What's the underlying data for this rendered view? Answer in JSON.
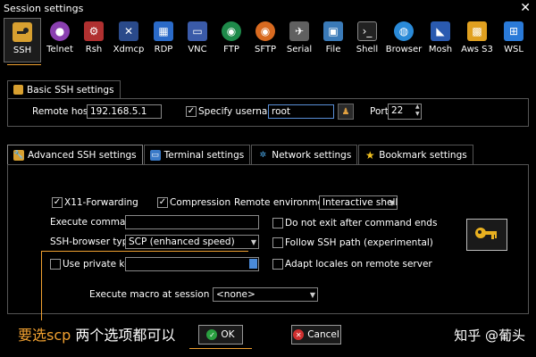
{
  "window": {
    "title": "Session settings",
    "close_glyph": "✕"
  },
  "protocols": [
    {
      "label": "SSH",
      "icon": "ssh-icon",
      "selected": true
    },
    {
      "label": "Telnet",
      "icon": "telnet-icon"
    },
    {
      "label": "Rsh",
      "icon": "rsh-icon"
    },
    {
      "label": "Xdmcp",
      "icon": "xdmcp-icon"
    },
    {
      "label": "RDP",
      "icon": "rdp-icon"
    },
    {
      "label": "VNC",
      "icon": "vnc-icon"
    },
    {
      "label": "FTP",
      "icon": "ftp-icon"
    },
    {
      "label": "SFTP",
      "icon": "sftp-icon"
    },
    {
      "label": "Serial",
      "icon": "serial-icon"
    },
    {
      "label": "File",
      "icon": "file-icon"
    },
    {
      "label": "Shell",
      "icon": "shell-icon"
    },
    {
      "label": "Browser",
      "icon": "browser-icon"
    },
    {
      "label": "Mosh",
      "icon": "mosh-icon"
    },
    {
      "label": "Aws S3",
      "icon": "aws-s3-icon"
    },
    {
      "label": "WSL",
      "icon": "wsl-icon"
    }
  ],
  "basic": {
    "tab_label": "Basic SSH settings",
    "remote_host_label": "Remote host *",
    "remote_host_value": "192.168.5.1",
    "specify_username_label": "Specify username",
    "specify_username_checked": true,
    "username_value": "root",
    "port_label": "Port",
    "port_value": "22"
  },
  "advanced": {
    "tabs": [
      {
        "label": "Advanced SSH settings",
        "active": true
      },
      {
        "label": "Terminal settings"
      },
      {
        "label": "Network settings"
      },
      {
        "label": "Bookmark settings"
      }
    ],
    "x11_label": "X11-Forwarding",
    "x11_checked": true,
    "compression_label": "Compression",
    "compression_checked": true,
    "remote_env_label": "Remote environment:",
    "remote_env_value": "Interactive shell",
    "exec_cmd_label": "Execute command:",
    "exec_cmd_value": "",
    "no_exit_label": "Do not exit after command ends",
    "browser_type_label": "SSH-browser type:",
    "browser_type_value": "SCP (enhanced speed)",
    "follow_ssh_label": "Follow SSH path (experimental)",
    "private_key_label": "Use private key",
    "adapt_locales_label": "Adapt locales on remote server",
    "macro_label": "Execute macro at session start:",
    "macro_value": "<none>"
  },
  "annotation": {
    "text_prefix": "要选",
    "text_highlight": "scp",
    "text_suffix": " 两个选项都可以",
    "color": "#f0a030"
  },
  "buttons": {
    "ok_label": "OK",
    "cancel_label": "Cancel"
  },
  "watermark": "知乎 @葡头"
}
